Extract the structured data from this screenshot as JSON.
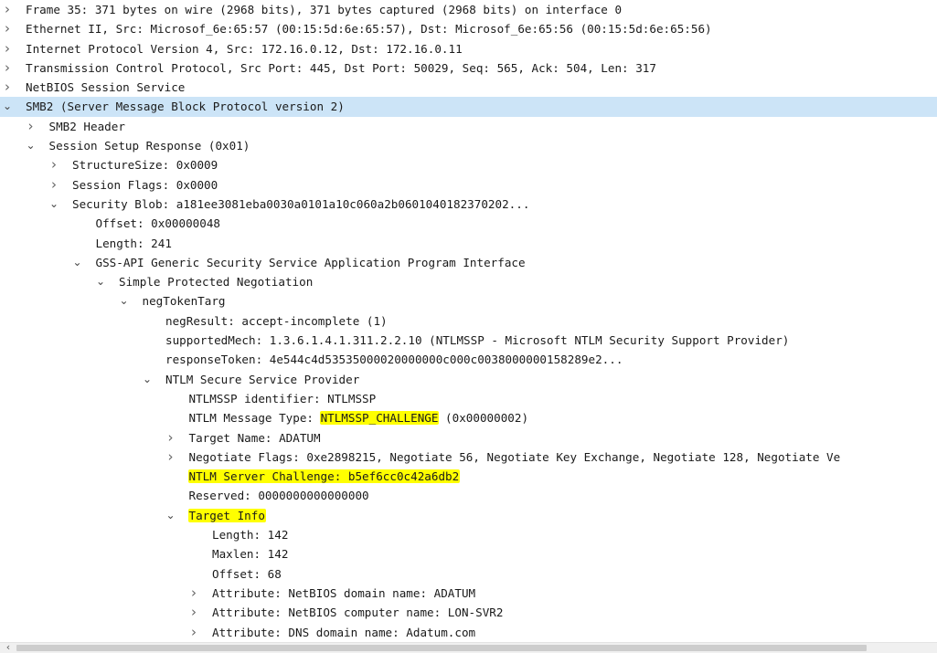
{
  "icons": {
    "expanded": "chevron-down-icon",
    "collapsed": "chevron-right-icon",
    "expanded_glyph": "⌄",
    "collapsed_glyph": "›"
  },
  "colors": {
    "selected_row": "#cce4f7",
    "highlight": "#ffff00"
  },
  "rows": [
    {
      "level": 0,
      "toggle": "collapsed",
      "text": "Frame 35: 371 bytes on wire (2968 bits), 371 bytes captured (2968 bits) on interface 0"
    },
    {
      "level": 0,
      "toggle": "collapsed",
      "text": "Ethernet II, Src: Microsof_6e:65:57 (00:15:5d:6e:65:57), Dst: Microsof_6e:65:56 (00:15:5d:6e:65:56)"
    },
    {
      "level": 0,
      "toggle": "collapsed",
      "text": "Internet Protocol Version 4, Src: 172.16.0.12, Dst: 172.16.0.11"
    },
    {
      "level": 0,
      "toggle": "collapsed",
      "text": "Transmission Control Protocol, Src Port: 445, Dst Port: 50029, Seq: 565, Ack: 504, Len: 317"
    },
    {
      "level": 0,
      "toggle": "collapsed",
      "text": "NetBIOS Session Service"
    },
    {
      "level": 0,
      "toggle": "expanded",
      "selected": true,
      "text": "SMB2 (Server Message Block Protocol version 2)"
    },
    {
      "level": 1,
      "toggle": "collapsed",
      "text": "SMB2 Header"
    },
    {
      "level": 1,
      "toggle": "expanded",
      "text": "Session Setup Response (0x01)"
    },
    {
      "level": 2,
      "toggle": "collapsed",
      "text": "StructureSize: 0x0009"
    },
    {
      "level": 2,
      "toggle": "collapsed",
      "text": "Session Flags: 0x0000"
    },
    {
      "level": 2,
      "toggle": "expanded",
      "text": "Security Blob: a181ee3081eba0030a0101a10c060a2b0601040182370202..."
    },
    {
      "level": 3,
      "toggle": "none",
      "text": "Offset: 0x00000048"
    },
    {
      "level": 3,
      "toggle": "none",
      "text": "Length: 241"
    },
    {
      "level": 3,
      "toggle": "expanded",
      "text": "GSS-API Generic Security Service Application Program Interface"
    },
    {
      "level": 4,
      "toggle": "expanded",
      "text": "Simple Protected Negotiation"
    },
    {
      "level": 5,
      "toggle": "expanded",
      "text": "negTokenTarg"
    },
    {
      "level": 6,
      "toggle": "none",
      "text": "negResult: accept-incomplete (1)"
    },
    {
      "level": 6,
      "toggle": "none",
      "text": "supportedMech: 1.3.6.1.4.1.311.2.2.10 (NTLMSSP - Microsoft NTLM Security Support Provider)"
    },
    {
      "level": 6,
      "toggle": "none",
      "text": "responseToken: 4e544c4d53535000020000000c000c0038000000158289e2..."
    },
    {
      "level": 6,
      "toggle": "expanded",
      "text": "NTLM Secure Service Provider"
    },
    {
      "level": 7,
      "toggle": "none",
      "text": "NTLMSSP identifier: NTLMSSP"
    },
    {
      "level": 7,
      "toggle": "none",
      "text_before": "NTLM Message Type: ",
      "text_hl": "NTLMSSP_CHALLENGE",
      "text_after": " (0x00000002)"
    },
    {
      "level": 7,
      "toggle": "collapsed",
      "text": "Target Name: ADATUM"
    },
    {
      "level": 7,
      "toggle": "collapsed",
      "text": "Negotiate Flags: 0xe2898215, Negotiate 56, Negotiate Key Exchange, Negotiate 128, Negotiate Ve"
    },
    {
      "level": 7,
      "toggle": "none",
      "text_before": "",
      "text_hl": "NTLM Server Challenge: b5ef6cc0c42a6db2",
      "text_after": ""
    },
    {
      "level": 7,
      "toggle": "none",
      "text": "Reserved: 0000000000000000"
    },
    {
      "level": 7,
      "toggle": "expanded",
      "text_before": "",
      "text_hl": "Target Info",
      "text_after": ""
    },
    {
      "level": 8,
      "toggle": "none",
      "text": "Length: 142"
    },
    {
      "level": 8,
      "toggle": "none",
      "text": "Maxlen: 142"
    },
    {
      "level": 8,
      "toggle": "none",
      "text": "Offset: 68"
    },
    {
      "level": 8,
      "toggle": "collapsed",
      "text": "Attribute: NetBIOS domain name: ADATUM"
    },
    {
      "level": 8,
      "toggle": "collapsed",
      "text": "Attribute: NetBIOS computer name: LON-SVR2"
    },
    {
      "level": 8,
      "toggle": "collapsed",
      "text": "Attribute: DNS domain name: Adatum.com"
    }
  ],
  "scrollbar": {
    "left_arrow_glyph": "‹"
  }
}
